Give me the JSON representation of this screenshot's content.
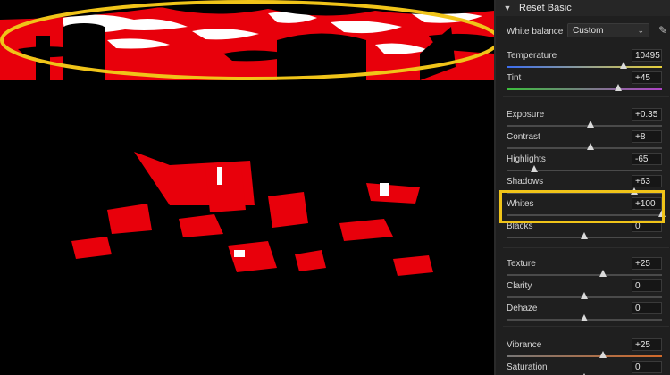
{
  "panel": {
    "title": "Reset Basic",
    "white_balance": {
      "label": "White balance",
      "value": "Custom"
    },
    "sliders": [
      {
        "label": "Temperature",
        "value": "10495",
        "level": 0.75,
        "track": "linear-gradient(90deg,#3a6cf0,#e8d13a)"
      },
      {
        "label": "Tint",
        "value": "+45",
        "level": 0.72,
        "track": "linear-gradient(90deg,#3bbf3b,#b043c8)"
      },
      {
        "label": "Exposure",
        "value": "+0.35",
        "level": 0.54,
        "track": "#4a4a4a"
      },
      {
        "label": "Contrast",
        "value": "+8",
        "level": 0.54,
        "track": "#4a4a4a"
      },
      {
        "label": "Highlights",
        "value": "-65",
        "level": 0.18,
        "track": "#4a4a4a"
      },
      {
        "label": "Shadows",
        "value": "+63",
        "level": 0.82,
        "track": "#4a4a4a"
      },
      {
        "label": "Whites",
        "value": "+100",
        "level": 1.0,
        "track": "#4a4a4a"
      },
      {
        "label": "Blacks",
        "value": "0",
        "level": 0.5,
        "track": "#4a4a4a"
      },
      {
        "label": "Texture",
        "value": "+25",
        "level": 0.62,
        "track": "#4a4a4a"
      },
      {
        "label": "Clarity",
        "value": "0",
        "level": 0.5,
        "track": "#4a4a4a"
      },
      {
        "label": "Dehaze",
        "value": "0",
        "level": 0.5,
        "track": "#4a4a4a"
      },
      {
        "label": "Vibrance",
        "value": "+25",
        "level": 0.62,
        "track": "linear-gradient(90deg,#777,#d26a2a)"
      },
      {
        "label": "Saturation",
        "value": "0",
        "level": 0.5,
        "track": "linear-gradient(90deg,#777,#d26a2a)"
      }
    ]
  },
  "colors": {
    "highlight": "#f0c419",
    "clipping": "#e8000b"
  },
  "icons": {
    "collapse": "chevron-down-icon",
    "dropdown": "caret-down-icon",
    "picker": "eyedropper-icon"
  }
}
